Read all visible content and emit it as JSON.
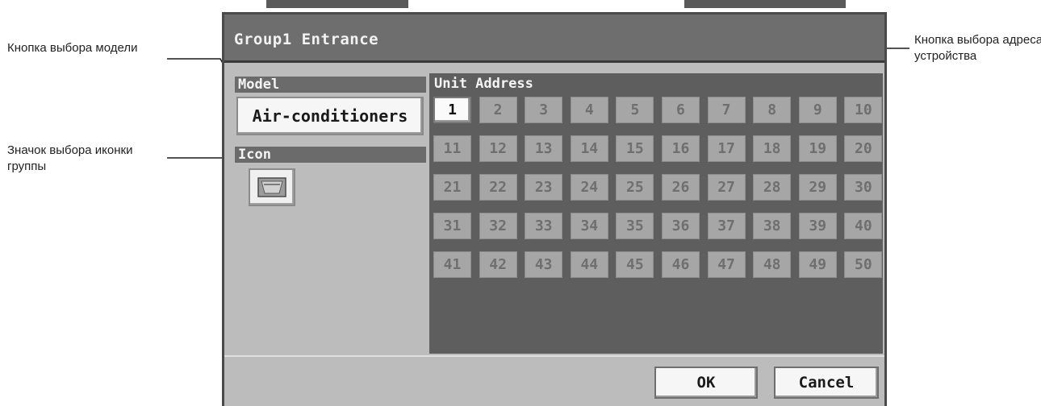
{
  "annotations": {
    "model_button": "Кнопка выбора модели",
    "icon_button": "Значок выбора иконки группы",
    "address_button": "Кнопка выбора адреса устройства"
  },
  "dialog": {
    "title": "Group1 Entrance",
    "model_label": "Model",
    "model_value": "Air-conditioners",
    "icon_label": "Icon",
    "icon_name": "indoor-unit-icon",
    "address_label": "Unit Address",
    "addresses": [
      "1",
      "2",
      "3",
      "4",
      "5",
      "6",
      "7",
      "8",
      "9",
      "10",
      "11",
      "12",
      "13",
      "14",
      "15",
      "16",
      "17",
      "18",
      "19",
      "20",
      "21",
      "22",
      "23",
      "24",
      "25",
      "26",
      "27",
      "28",
      "29",
      "30",
      "31",
      "32",
      "33",
      "34",
      "35",
      "36",
      "37",
      "38",
      "39",
      "40",
      "41",
      "42",
      "43",
      "44",
      "45",
      "46",
      "47",
      "48",
      "49",
      "50"
    ],
    "selected_address": "1",
    "ok_label": "OK",
    "cancel_label": "Cancel"
  }
}
